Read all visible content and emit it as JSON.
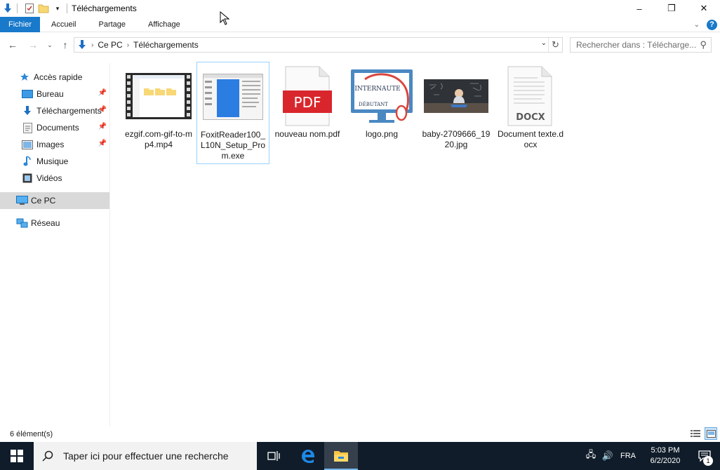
{
  "window": {
    "title": "Téléchargements",
    "controls": {
      "minimize": "–",
      "maximize": "❐",
      "close": "✕"
    }
  },
  "ribbon": {
    "tabs": [
      {
        "label": "Fichier",
        "active": true
      },
      {
        "label": "Accueil",
        "active": false
      },
      {
        "label": "Partage",
        "active": false
      },
      {
        "label": "Affichage",
        "active": false
      }
    ],
    "help": "?"
  },
  "address": {
    "crumbs": [
      "Ce PC",
      "Téléchargements"
    ],
    "search_placeholder": "Rechercher dans : Télécharge..."
  },
  "sidebar": {
    "items": [
      {
        "label": "Accès rapide",
        "icon": "star-icon",
        "pinned": false
      },
      {
        "label": "Bureau",
        "icon": "desktop-icon",
        "pinned": true
      },
      {
        "label": "Téléchargements",
        "icon": "download-icon",
        "pinned": true
      },
      {
        "label": "Documents",
        "icon": "documents-icon",
        "pinned": true
      },
      {
        "label": "Images",
        "icon": "images-icon",
        "pinned": true
      },
      {
        "label": "Musique",
        "icon": "music-icon",
        "pinned": false
      },
      {
        "label": "Vidéos",
        "icon": "videos-icon",
        "pinned": false
      },
      {
        "label": "Ce PC",
        "icon": "computer-icon",
        "selected": true
      },
      {
        "label": "Réseau",
        "icon": "network-icon",
        "pinned": false
      }
    ]
  },
  "files": [
    {
      "name": "ezgif.com-gif-to-mp4.mp4",
      "type": "video-thumbnail"
    },
    {
      "name": "FoxitReader100_L10N_Setup_Prom.exe",
      "type": "installer-thumbnail",
      "selected": true
    },
    {
      "name": "nouveau nom.pdf",
      "type": "pdf-icon"
    },
    {
      "name": "logo.png",
      "type": "logo-thumbnail",
      "logo_text_1": "INTERNAUTE",
      "logo_text_2": "DÉBUTANT"
    },
    {
      "name": "baby-2709666_1920.jpg",
      "type": "photo-thumbnail"
    },
    {
      "name": "Document texte.docx",
      "type": "docx-icon",
      "badge": "DOCX"
    }
  ],
  "pdf_badge": "PDF",
  "status": {
    "count": "6 élément(s)"
  },
  "taskbar": {
    "search_placeholder": "Taper ici pour effectuer une recherche",
    "language": "FRA",
    "time": "5:03 PM",
    "date": "6/2/2020",
    "notifications": "1"
  },
  "colors": {
    "accent": "#1979ca",
    "taskbar": "#101c2a",
    "selection_border": "#99d1ff",
    "pdf_red": "#d9262d"
  }
}
